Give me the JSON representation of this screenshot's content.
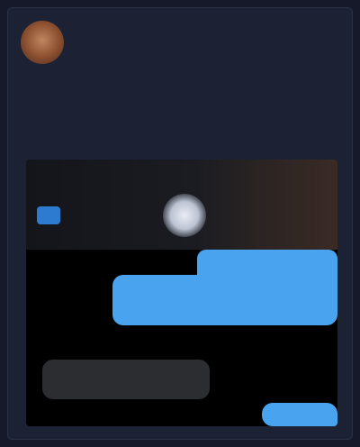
{
  "post": {
    "author": "",
    "text": ""
  },
  "media": {
    "top_left_label": "",
    "top_right_label": "",
    "incoming_label": "",
    "incoming_text": ""
  },
  "colors": {
    "background": "#16192a",
    "card": "#1c2233",
    "accent_bubble": "#4aa3ee",
    "incoming_bubble": "#2c2d31"
  }
}
